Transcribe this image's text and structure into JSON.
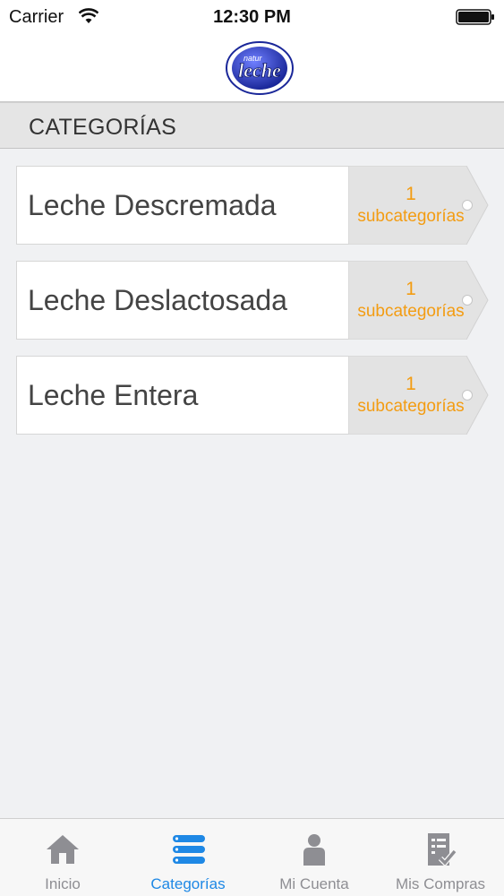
{
  "status_bar": {
    "carrier": "Carrier",
    "time": "12:30 PM"
  },
  "header": {
    "logo_text": "leche",
    "logo_subtext": "natur"
  },
  "section": {
    "title": "CATEGORÍAS"
  },
  "categories": [
    {
      "name": "Leche Descremada",
      "count": "1",
      "sub_label": "subcategorías"
    },
    {
      "name": "Leche Deslactosada",
      "count": "1",
      "sub_label": "subcategorías"
    },
    {
      "name": "Leche Entera",
      "count": "1",
      "sub_label": "subcategorías"
    }
  ],
  "tabs": [
    {
      "label": "Inicio",
      "icon": "home-icon",
      "active": false
    },
    {
      "label": "Categorías",
      "icon": "list-icon",
      "active": true
    },
    {
      "label": "Mi Cuenta",
      "icon": "user-icon",
      "active": false
    },
    {
      "label": "Mis Compras",
      "icon": "receipt-icon",
      "active": false
    }
  ],
  "colors": {
    "accent": "#1e88e5",
    "subcategory_text": "#f39c12",
    "inactive_tab": "#8e8e93",
    "logo_blue": "#2b3fc2"
  }
}
